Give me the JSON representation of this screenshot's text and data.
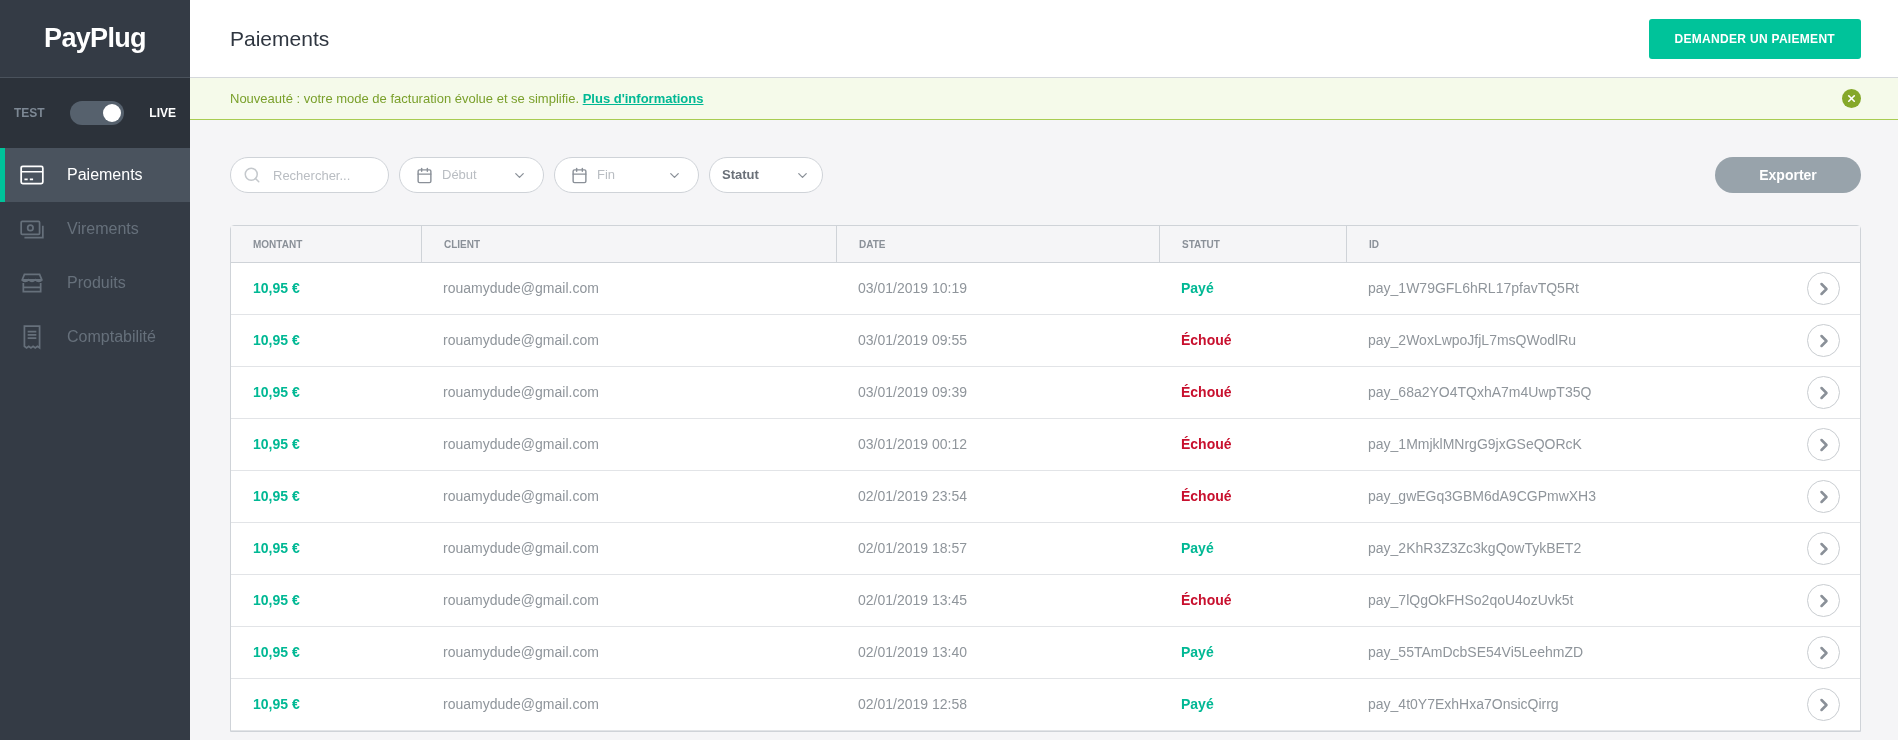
{
  "sidebar": {
    "logo": "PayPlug",
    "mode_toggle": {
      "left_label": "TEST",
      "right_label": "LIVE",
      "on": true
    },
    "items": [
      {
        "label": "Paiements",
        "kind": "card",
        "selected": true
      },
      {
        "label": "Virements",
        "kind": "money",
        "selected": false
      },
      {
        "label": "Produits",
        "kind": "store",
        "selected": false
      },
      {
        "label": "Comptabilité",
        "kind": "receipt",
        "selected": false
      }
    ]
  },
  "header": {
    "title": "Paiements",
    "action_button": "DEMANDER UN PAIEMENT"
  },
  "banner": {
    "text": "Nouveauté : votre mode de facturation évolue et se simplifie.",
    "link": "Plus d'informations"
  },
  "filters": {
    "search": {
      "placeholder": "Rechercher..."
    },
    "start": {
      "placeholder": "Début"
    },
    "end": {
      "placeholder": "Fin"
    },
    "status": {
      "value": "Statut"
    },
    "export_button": "Exporter"
  },
  "table": {
    "columns": [
      "MONTANT",
      "CLIENT",
      "DATE",
      "STATUT",
      "ID"
    ],
    "rows": [
      {
        "amount": "10,95 €",
        "client": "rouamydude@gmail.com",
        "date": "03/01/2019 10:19",
        "status": "Payé",
        "kind": "paid",
        "id": "pay_1W79GFL6hRL17pfavTQ5Rt"
      },
      {
        "amount": "10,95 €",
        "client": "rouamydude@gmail.com",
        "date": "03/01/2019 09:55",
        "status": "Échoué",
        "kind": "failed",
        "id": "pay_2WoxLwpoJfjL7msQWodlRu"
      },
      {
        "amount": "10,95 €",
        "client": "rouamydude@gmail.com",
        "date": "03/01/2019 09:39",
        "status": "Échoué",
        "kind": "failed",
        "id": "pay_68a2YO4TQxhA7m4UwpT35Q"
      },
      {
        "amount": "10,95 €",
        "client": "rouamydude@gmail.com",
        "date": "03/01/2019 00:12",
        "status": "Échoué",
        "kind": "failed",
        "id": "pay_1MmjklMNrgG9jxGSeQORcK"
      },
      {
        "amount": "10,95 €",
        "client": "rouamydude@gmail.com",
        "date": "02/01/2019 23:54",
        "status": "Échoué",
        "kind": "failed",
        "id": "pay_gwEGq3GBM6dA9CGPmwXH3"
      },
      {
        "amount": "10,95 €",
        "client": "rouamydude@gmail.com",
        "date": "02/01/2019 18:57",
        "status": "Payé",
        "kind": "paid",
        "id": "pay_2KhR3Z3Zc3kgQowTykBET2"
      },
      {
        "amount": "10,95 €",
        "client": "rouamydude@gmail.com",
        "date": "02/01/2019 13:45",
        "status": "Échoué",
        "kind": "failed",
        "id": "pay_7lQgOkFHSo2qoU4ozUvk5t"
      },
      {
        "amount": "10,95 €",
        "client": "rouamydude@gmail.com",
        "date": "02/01/2019 13:40",
        "status": "Payé",
        "kind": "paid",
        "id": "pay_55TAmDcbSE54Vi5LeehmZD"
      },
      {
        "amount": "10,95 €",
        "client": "rouamydude@gmail.com",
        "date": "02/01/2019 12:58",
        "status": "Payé",
        "kind": "paid",
        "id": "pay_4t0Y7ExhHxa7OnsicQirrg"
      }
    ]
  }
}
